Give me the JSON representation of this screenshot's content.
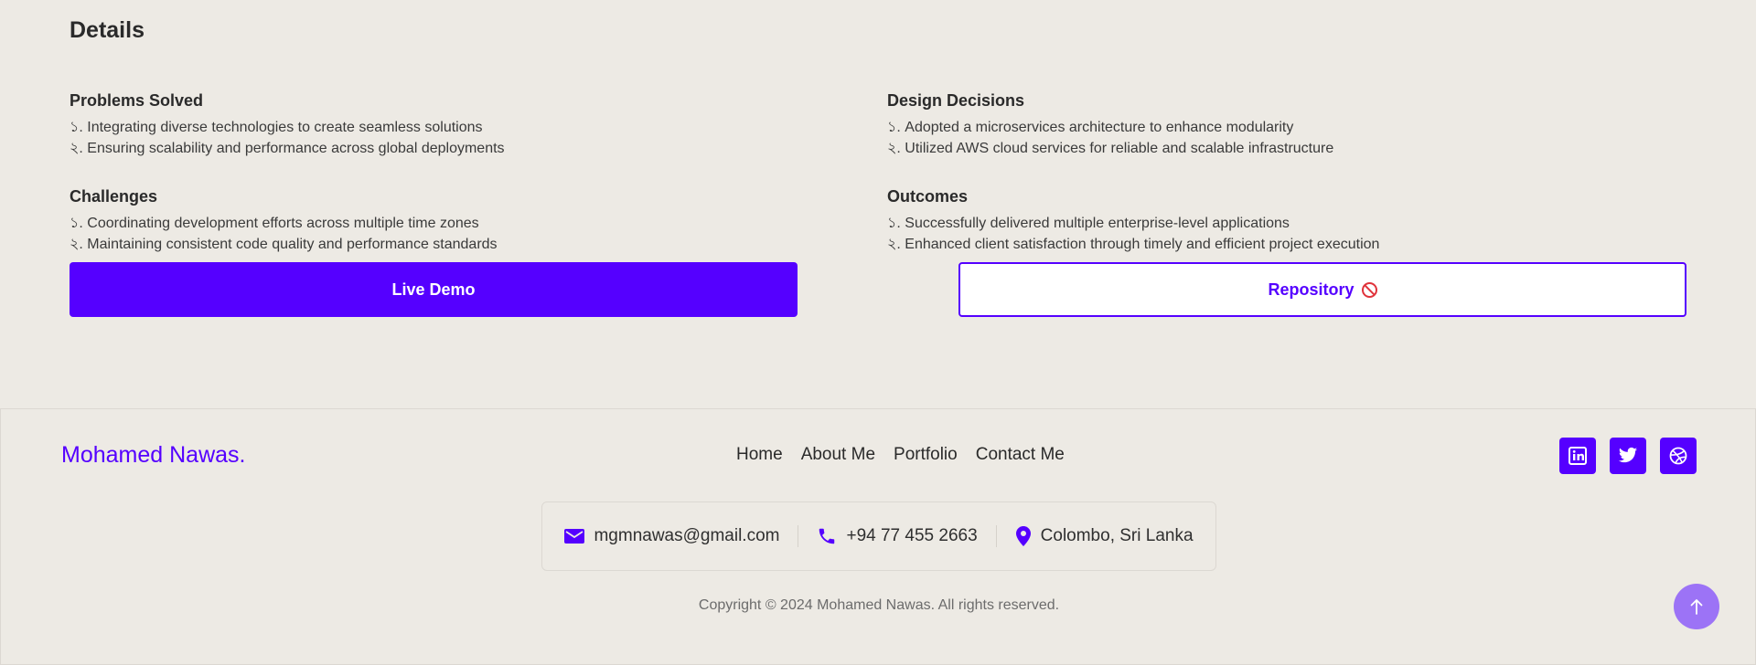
{
  "details": {
    "title": "Details",
    "sections": {
      "problems": {
        "heading": "Problems Solved",
        "items": [
          "১. Integrating diverse technologies to create seamless solutions",
          "২. Ensuring scalability and performance across global deployments"
        ]
      },
      "design": {
        "heading": "Design Decisions",
        "items": [
          "১. Adopted a microservices architecture to enhance modularity",
          "২. Utilized AWS cloud services for reliable and scalable infrastructure"
        ]
      },
      "challenges": {
        "heading": "Challenges",
        "items": [
          "১. Coordinating development efforts across multiple time zones",
          "২. Maintaining consistent code quality and performance standards"
        ]
      },
      "outcomes": {
        "heading": "Outcomes",
        "items": [
          "১. Successfully delivered multiple enterprise-level applications",
          "২. Enhanced client satisfaction through timely and efficient project execution"
        ]
      }
    },
    "buttons": {
      "live_demo": "Live Demo",
      "repository": "Repository"
    }
  },
  "footer": {
    "brand": "Mohamed Nawas.",
    "nav": [
      "Home",
      "About Me",
      "Portfolio",
      "Contact Me"
    ],
    "socials": [
      "linkedin-icon",
      "twitter-icon",
      "dribbble-icon"
    ],
    "contact": {
      "email": "mgmnawas@gmail.com",
      "phone": "+94 77 455 2663",
      "location": "Colombo, Sri Lanka"
    },
    "copyright": "Copyright © 2024 Mohamed Nawas. All rights reserved."
  },
  "colors": {
    "accent": "#5500ff",
    "background": "#edeae4",
    "back_to_top": "#9c73f6",
    "forbidden_icon": "#e0333b"
  }
}
